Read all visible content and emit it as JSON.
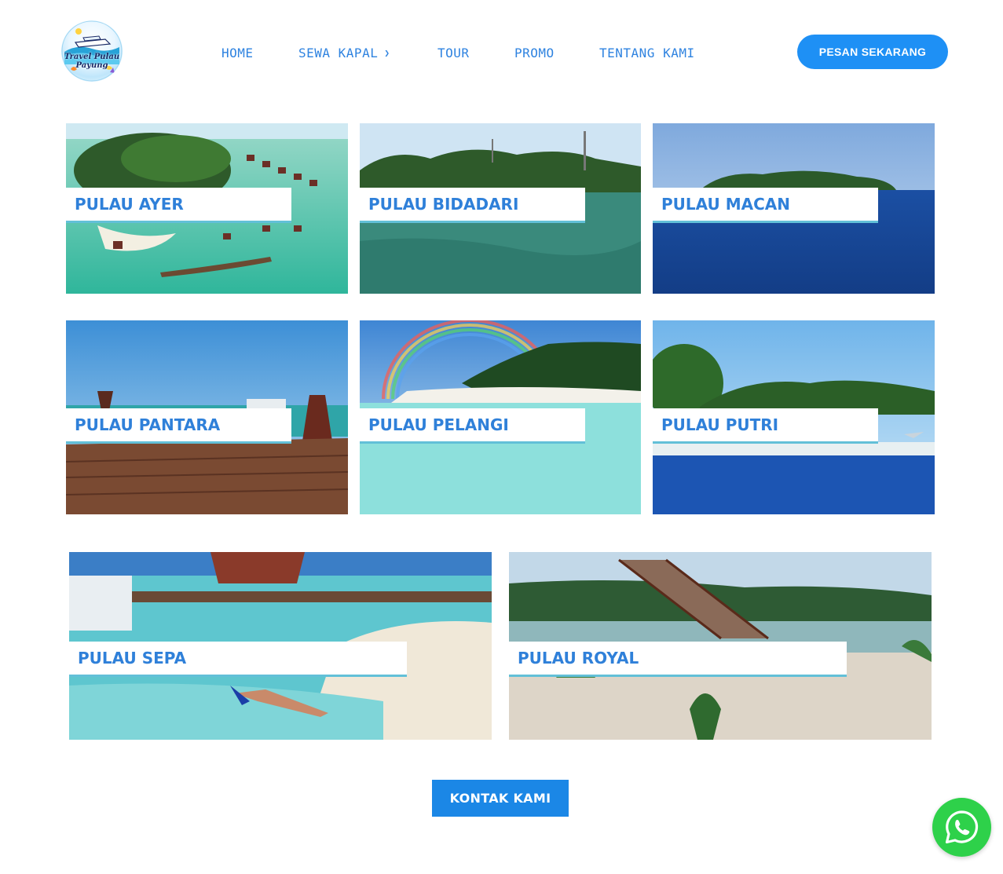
{
  "logo": {
    "line1": "Travel Pulau",
    "line2": "Payung"
  },
  "nav": {
    "items": [
      {
        "label": "HOME"
      },
      {
        "label": "SEWA KAPAL",
        "has_dropdown": true
      },
      {
        "label": "TOUR"
      },
      {
        "label": "PROMO"
      },
      {
        "label": "TENTANG KAMI"
      }
    ],
    "cta_label": "PESAN SEKARANG"
  },
  "islands": [
    {
      "label": "PULAU AYER"
    },
    {
      "label": "PULAU BIDADARI"
    },
    {
      "label": "PULAU MACAN"
    },
    {
      "label": "PULAU PANTARA"
    },
    {
      "label": "PULAU PELANGI"
    },
    {
      "label": "PULAU PUTRI"
    },
    {
      "label": "PULAU SEPA"
    },
    {
      "label": "PULAU ROYAL"
    }
  ],
  "contact_button": "KONTAK KAMI",
  "colors": {
    "accent": "#1e90f5",
    "nav_text": "#2f83e0",
    "label_text": "#2f80d9",
    "label_underline": "#62c0d8",
    "whatsapp": "#2ed14a"
  },
  "icons": {
    "whatsapp": "whatsapp-icon",
    "dropdown": "chevron-down-icon"
  }
}
